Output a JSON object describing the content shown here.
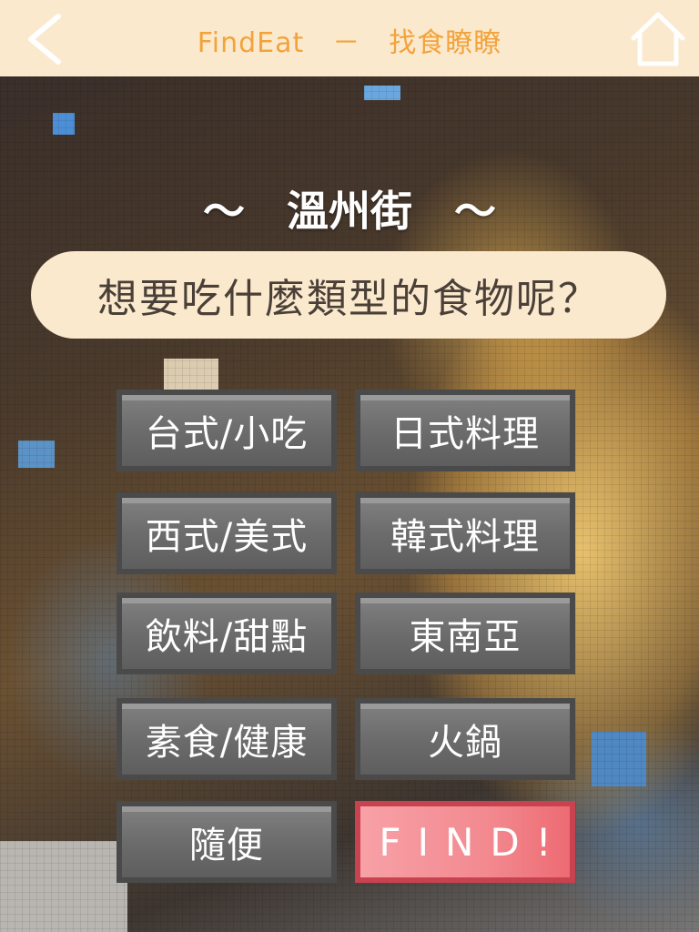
{
  "header": {
    "title": "FindEat　－　找食瞭瞭",
    "back_icon": "chevron-left-icon",
    "home_icon": "home-icon"
  },
  "location": "～　溫州街　～",
  "question": "想要吃什麼類型的食物呢？",
  "categories": [
    {
      "label": "台式/小吃"
    },
    {
      "label": "日式料理"
    },
    {
      "label": "西式/美式"
    },
    {
      "label": "韓式料理"
    },
    {
      "label": "飲料/甜點"
    },
    {
      "label": "東南亞"
    },
    {
      "label": "素食/健康"
    },
    {
      "label": "火鍋"
    },
    {
      "label": "隨便"
    }
  ],
  "find_label": "FIND!",
  "colors": {
    "header_bg": "#fbe9ce",
    "header_text": "#f2a33c",
    "button_gray": "#6c6c6c",
    "find_pink": "#f28a90"
  }
}
